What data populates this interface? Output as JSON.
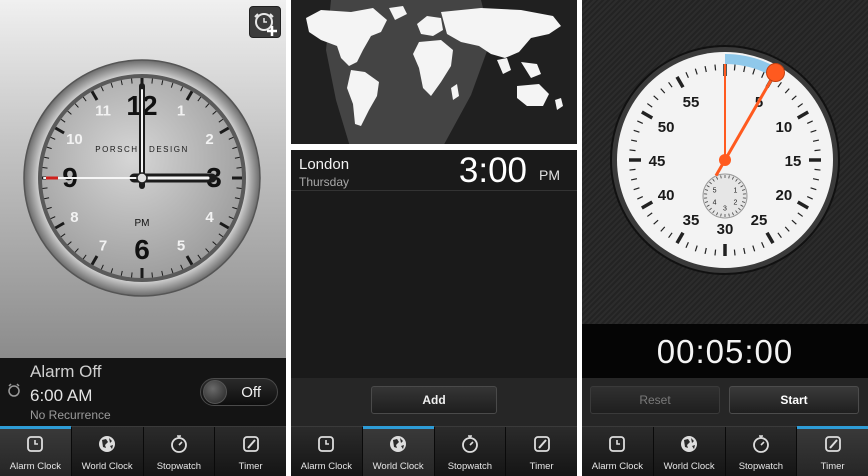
{
  "tabs": [
    {
      "id": "alarm",
      "label": "Alarm Clock",
      "icon": "alarm-clock-icon"
    },
    {
      "id": "world",
      "label": "World Clock",
      "icon": "globe-icon"
    },
    {
      "id": "stopwatch",
      "label": "Stopwatch",
      "icon": "stopwatch-icon"
    },
    {
      "id": "timer",
      "label": "Timer",
      "icon": "timer-icon"
    }
  ],
  "alarm_screen": {
    "active_tab": "alarm",
    "brand": "PORSCHE DESIGN",
    "dial_numerals": [
      "12",
      "1",
      "2",
      "3",
      "4",
      "5",
      "6",
      "7",
      "8",
      "9",
      "10",
      "11"
    ],
    "ampm": "PM",
    "time_shown": {
      "hour": 3,
      "minute": 0,
      "second": 45
    },
    "status": "Alarm Off",
    "alarm_time": "6:00 AM",
    "recurrence": "No Recurrence",
    "toggle_label": "Off",
    "add_icon": "add-alarm-icon",
    "bell_icon": "bell-icon"
  },
  "world_screen": {
    "active_tab": "world",
    "city": "London",
    "day": "Thursday",
    "time": "3:00",
    "ampm": "PM",
    "add_label": "Add"
  },
  "stopwatch_screen": {
    "active_tab": "timer",
    "dial_numbers": [
      "5",
      "10",
      "15",
      "20",
      "25",
      "30",
      "35",
      "40",
      "45",
      "50",
      "55"
    ],
    "subdial_numbers": [
      "1",
      "2",
      "3",
      "4",
      "5"
    ],
    "elapsed_seconds": 5,
    "display": "00:05:00",
    "reset_label": "Reset",
    "start_label": "Start",
    "accent_color": "#ff5a1f",
    "arc_color": "#8fc8ea"
  }
}
